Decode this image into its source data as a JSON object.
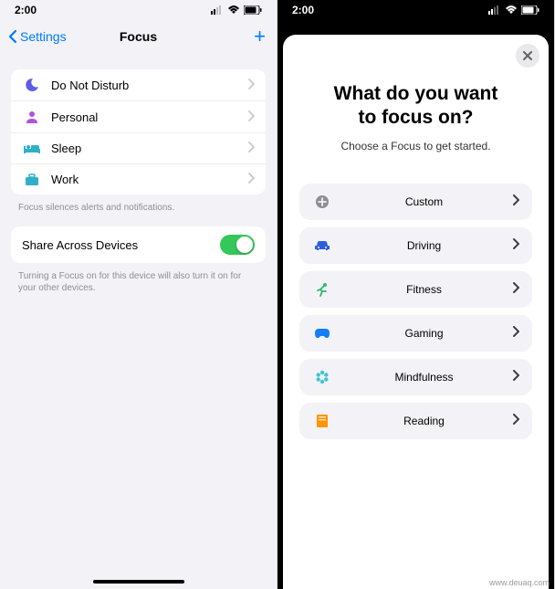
{
  "status": {
    "time": "2:00"
  },
  "left": {
    "back_label": "Settings",
    "title": "Focus",
    "items": [
      {
        "label": "Do Not Disturb",
        "icon": "moon",
        "color": "#5e5ce6"
      },
      {
        "label": "Personal",
        "icon": "person",
        "color": "#af52de"
      },
      {
        "label": "Sleep",
        "icon": "bed",
        "color": "#30b0c7"
      },
      {
        "label": "Work",
        "icon": "briefcase",
        "color": "#30b0c7"
      }
    ],
    "footer1": "Focus silences alerts and notifications.",
    "share_label": "Share Across Devices",
    "share_on": true,
    "footer2": "Turning a Focus on for this device will also turn it on for your other devices."
  },
  "right": {
    "title_line1": "What do you want",
    "title_line2": "to focus on?",
    "subtitle": "Choose a Focus to get started.",
    "options": [
      {
        "label": "Custom",
        "icon": "plus-circle",
        "color": "#8e8e93"
      },
      {
        "label": "Driving",
        "icon": "car",
        "color": "#2b5fde"
      },
      {
        "label": "Fitness",
        "icon": "runner",
        "color": "#2fb968"
      },
      {
        "label": "Gaming",
        "icon": "game",
        "color": "#147df5"
      },
      {
        "label": "Mindfulness",
        "icon": "mind",
        "color": "#3ac6d4"
      },
      {
        "label": "Reading",
        "icon": "book",
        "color": "#ff9500"
      }
    ]
  },
  "watermark": "www.deuaq.com"
}
